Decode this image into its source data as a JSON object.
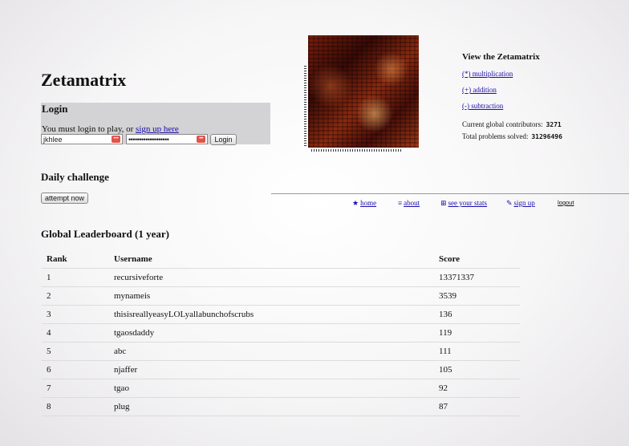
{
  "site": {
    "title": "Zetamatrix"
  },
  "login": {
    "heading": "Login",
    "message": "You must login to play, or",
    "signup_link": "sign up here",
    "username_value": "jkhlee",
    "password_mask": "•••••••••••••••••••",
    "field_badge": "•••",
    "button_label": "Login"
  },
  "daily": {
    "heading": "Daily challenge",
    "button_label": "attempt now"
  },
  "side": {
    "heading": "View the Zetamatrix",
    "links": [
      {
        "label": "(*) multiplication"
      },
      {
        "label": "(+) addition"
      },
      {
        "label": "(-) subtraction"
      }
    ],
    "contributors_label": "Current global contributors:",
    "contributors_value": "3271",
    "problems_label": "Total problems solved:",
    "problems_value": "31296496"
  },
  "nav": {
    "items": [
      {
        "icon": "★",
        "icon_name": "star-icon",
        "label": "home"
      },
      {
        "icon": "≡",
        "icon_name": "info-icon",
        "label": "about"
      },
      {
        "icon": "⊞",
        "icon_name": "stats-icon",
        "label": "see your stats"
      },
      {
        "icon": "✎",
        "icon_name": "pencil-icon",
        "label": "sign up"
      }
    ],
    "logout_label": "logout"
  },
  "leaderboard": {
    "heading": "Global Leaderboard (1 year)",
    "columns": [
      "Rank",
      "Username",
      "Score"
    ],
    "rows": [
      {
        "rank": "1",
        "username": "recursiveforte",
        "score": "13371337"
      },
      {
        "rank": "2",
        "username": "mynameis",
        "score": "3539"
      },
      {
        "rank": "3",
        "username": "thisisreallyeasyLOLyallabunchofscrubs",
        "score": "136"
      },
      {
        "rank": "4",
        "username": "tgaosdaddy",
        "score": "119"
      },
      {
        "rank": "5",
        "username": "abc",
        "score": "111"
      },
      {
        "rank": "6",
        "username": "njaffer",
        "score": "105"
      },
      {
        "rank": "7",
        "username": "tgao",
        "score": "92"
      },
      {
        "rank": "8",
        "username": "plug",
        "score": "87"
      }
    ]
  }
}
